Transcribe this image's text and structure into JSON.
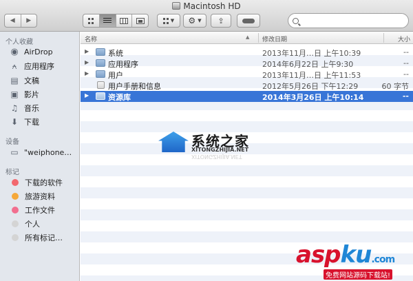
{
  "window": {
    "title": "Macintosh HD"
  },
  "toolbar": {
    "nav": {
      "back": "◀",
      "forward": "▶"
    },
    "views": [
      "icons",
      "list",
      "columns",
      "cover-flow"
    ],
    "active_view": "list",
    "search_placeholder": ""
  },
  "sidebar": {
    "favorites_header": "个人收藏",
    "favorites": [
      {
        "label": "AirDrop",
        "icon": "airdrop-icon",
        "glyph": "◉"
      },
      {
        "label": "应用程序",
        "icon": "applications-icon",
        "glyph": "⍲"
      },
      {
        "label": "文稿",
        "icon": "documents-icon",
        "glyph": "▤"
      },
      {
        "label": "影片",
        "icon": "movies-icon",
        "glyph": "▣"
      },
      {
        "label": "音乐",
        "icon": "music-icon",
        "glyph": "♫"
      },
      {
        "label": "下载",
        "icon": "downloads-icon",
        "glyph": "⬇"
      }
    ],
    "devices_header": "设备",
    "devices": [
      {
        "label": "\"weiphone…",
        "icon": "computer-icon",
        "glyph": "▭"
      }
    ],
    "tags_header": "标记",
    "tags": [
      {
        "label": "下载的软件",
        "color": "#f2686e"
      },
      {
        "label": "旅游资料",
        "color": "#f5a83a"
      },
      {
        "label": "工作文件",
        "color": "#f26f8f"
      },
      {
        "label": "个人",
        "color": "#d4d4d4"
      },
      {
        "label": "所有标记…",
        "color": "#d4d4d4"
      }
    ]
  },
  "list": {
    "columns": {
      "name": "名称",
      "date": "修改日期",
      "size": "大小"
    },
    "rows": [
      {
        "name": "系统",
        "date": "2013年11月…日 上午10:39",
        "size": "--",
        "expandable": true,
        "kind": "folder"
      },
      {
        "name": "应用程序",
        "date": "2014年6月22日 上午9:30",
        "size": "--",
        "expandable": true,
        "kind": "folder"
      },
      {
        "name": "用户",
        "date": "2013年11月…日 上午11:53",
        "size": "--",
        "expandable": true,
        "kind": "folder"
      },
      {
        "name": "用户手册和信息",
        "date": "2012年5月26日 下午12:29",
        "size": "60 字节",
        "expandable": false,
        "kind": "doc"
      },
      {
        "name": "资源库",
        "date": "2014年3月26日 上午10:14",
        "size": "--",
        "expandable": true,
        "kind": "folder",
        "selected": true
      }
    ]
  },
  "watermarks": {
    "site1_cn": "系统之家",
    "site1_en": "XITONGZHIJIA.NET",
    "site2_a": "asp",
    "site2_b": "ku",
    "site2_c": ".com",
    "site2_sub": "免费网站源码下载站!"
  }
}
